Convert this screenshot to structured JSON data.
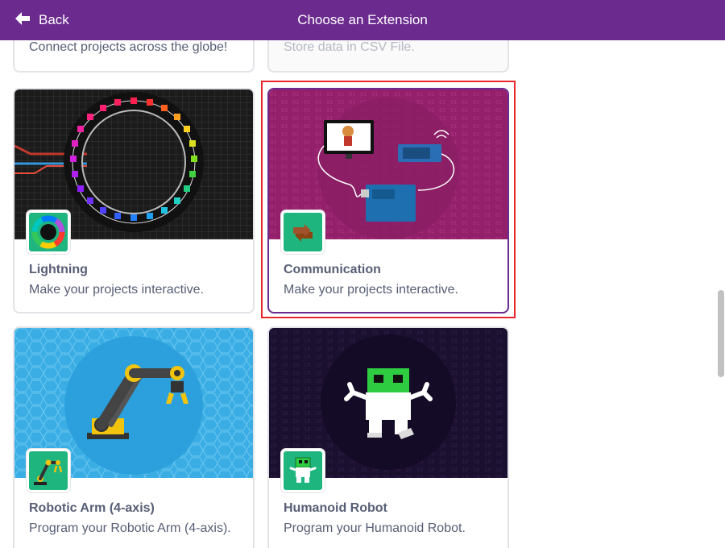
{
  "header": {
    "back_label": "Back",
    "title": "Choose an Extension"
  },
  "cards": {
    "partial_left": {
      "description": "Connect projects across the globe!"
    },
    "partial_right": {
      "description": "Store data in CSV File."
    },
    "lightning": {
      "name": "Lightning",
      "description": "Make your projects interactive.",
      "icon": "color-wheel-icon"
    },
    "communication": {
      "name": "Communication",
      "description": "Make your projects interactive.",
      "icon": "swap-arrows-icon"
    },
    "robotic_arm": {
      "name": "Robotic Arm (4-axis)",
      "description": "Program your Robotic Arm (4-axis).",
      "icon": "robotic-arm-icon"
    },
    "humanoid": {
      "name": "Humanoid Robot",
      "description": "Program your Humanoid Robot.",
      "icon": "robot-icon"
    }
  },
  "colors": {
    "header": "#6b2a8e",
    "selection_outline": "#e8262b",
    "text": "#575e75",
    "icon_bg": "#1fb57f"
  }
}
